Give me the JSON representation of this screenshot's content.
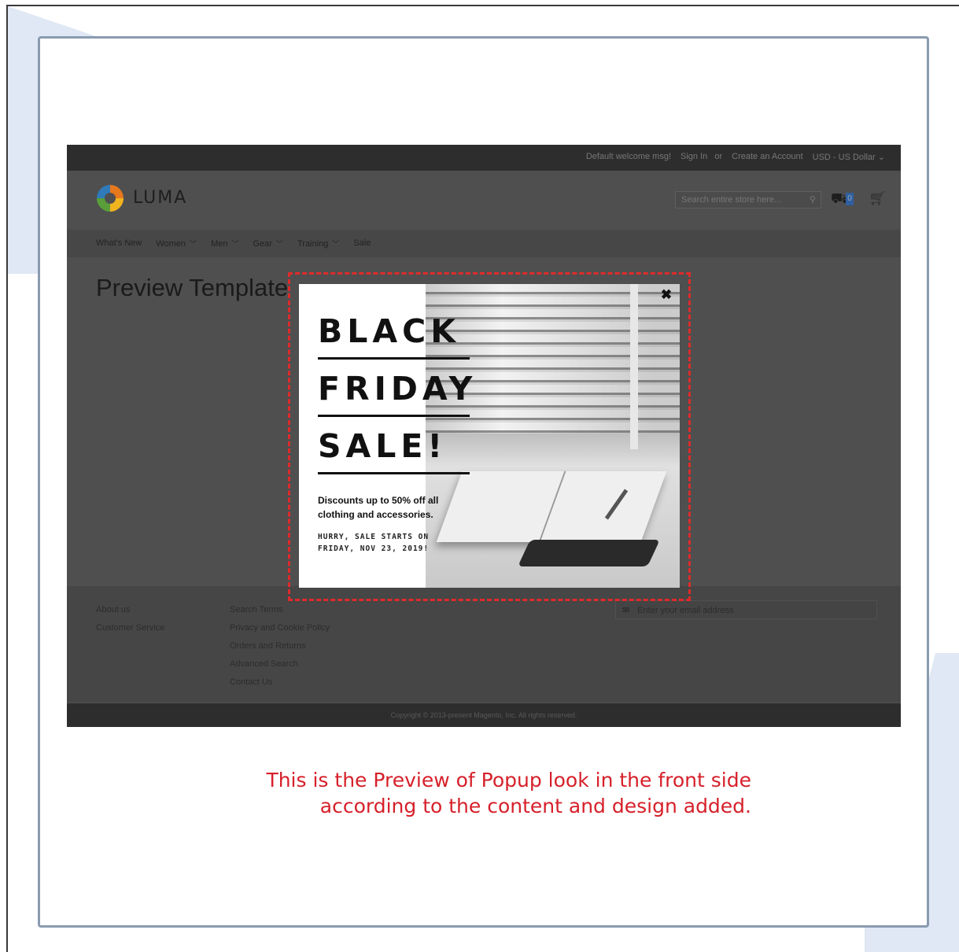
{
  "store": {
    "topbar": {
      "welcome": "Default welcome msg!",
      "sign_in": "Sign In",
      "or": "or",
      "create_account": "Create an Account",
      "currency": "USD - US Dollar"
    },
    "logo_text": "LUMA",
    "search_placeholder": "Search entire store here...",
    "compare_count": "0",
    "nav": [
      {
        "label": "What's New",
        "has_dropdown": false
      },
      {
        "label": "Women",
        "has_dropdown": true
      },
      {
        "label": "Men",
        "has_dropdown": true
      },
      {
        "label": "Gear",
        "has_dropdown": true
      },
      {
        "label": "Training",
        "has_dropdown": true
      },
      {
        "label": "Sale",
        "has_dropdown": false
      }
    ],
    "page_title": "Preview Template",
    "footer": {
      "col1": [
        "About us",
        "Customer Service"
      ],
      "col2": [
        "Search Terms",
        "Privacy and Cookie Policy",
        "Orders and Returns",
        "Advanced Search",
        "Contact Us"
      ],
      "newsletter_placeholder": "Enter your email address"
    },
    "copyright": "Copyright © 2013-present Magento, Inc. All rights reserved."
  },
  "popup": {
    "heading_lines": [
      "BLACK",
      "FRIDAY",
      "SALE!"
    ],
    "description": "Discounts up to 50% off all clothing and accessories.",
    "hurry_text": "HURRY, SALE STARTS ON FRIDAY, NOV 23, 2019!",
    "close_icon": "close-icon"
  },
  "caption": {
    "line1": "This is the Preview of Popup look in the front side",
    "line2": "according to the content and design added."
  },
  "colors": {
    "highlight": "#e02a2a",
    "caption": "#d6202a",
    "frame_border": "#8a9bb0",
    "decoration": "#dfe8f4"
  }
}
